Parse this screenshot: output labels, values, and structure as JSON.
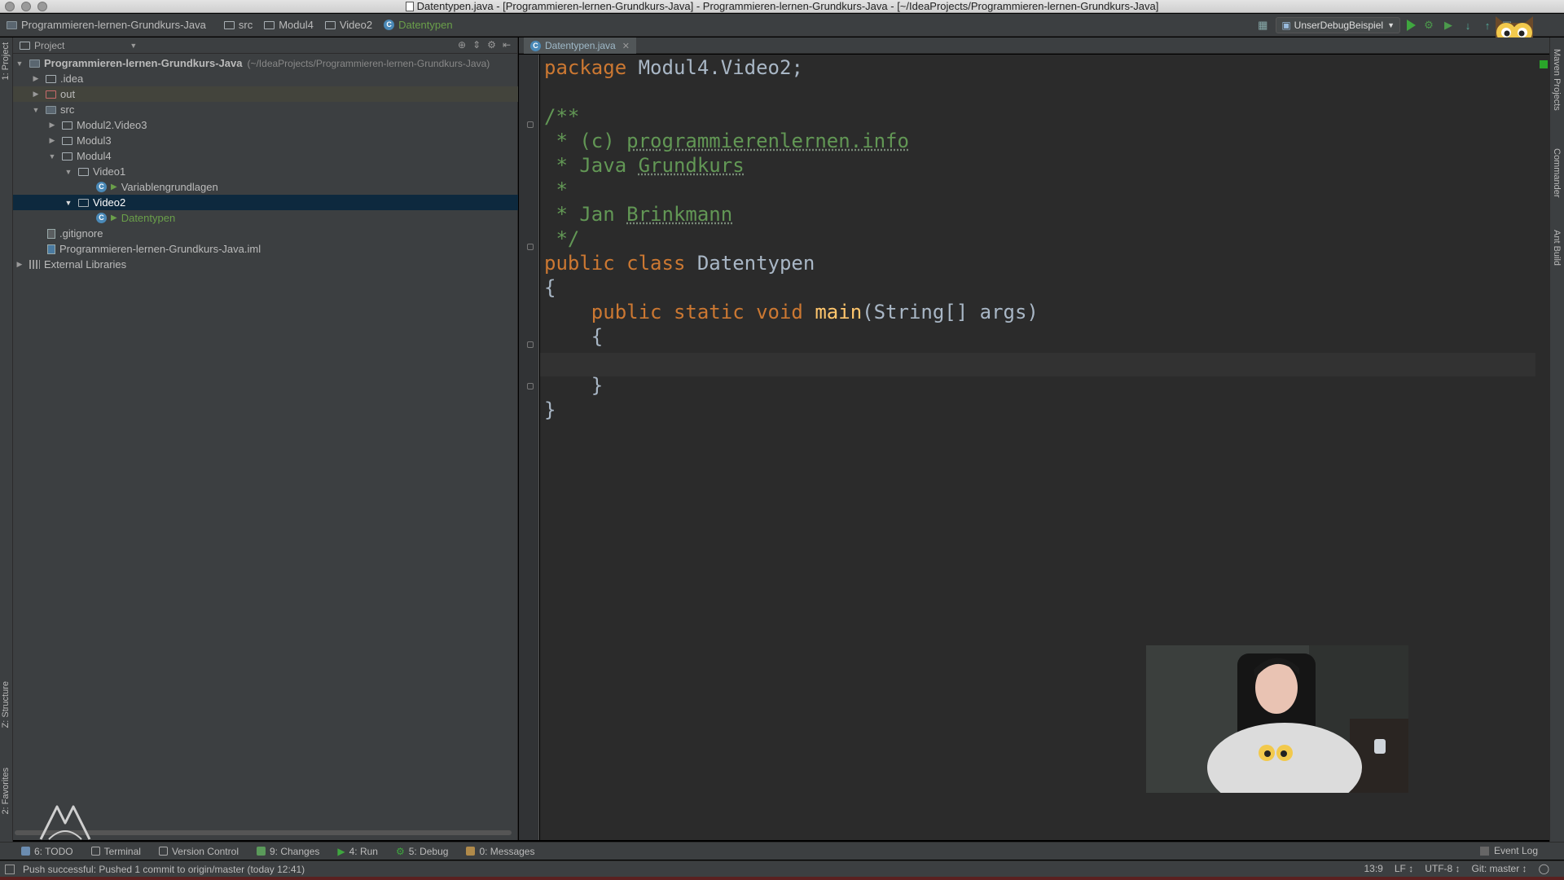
{
  "window": {
    "title": "Datentypen.java - [Programmieren-lernen-Grundkurs-Java] - Programmieren-lernen-Grundkurs-Java - [~/IdeaProjects/Programmieren-lernen-Grundkurs-Java]"
  },
  "navbar": {
    "breadcrumbs": [
      "Programmieren-lernen-Grundkurs-Java",
      "src",
      "Modul4",
      "Video2",
      "Datentypen"
    ],
    "run_config": "UnserDebugBeispiel",
    "icons": [
      "structure-icon",
      "run-icon",
      "debug-icon",
      "coverage-icon",
      "vcs-update-icon",
      "vcs-commit-icon",
      "settings-icon",
      "search-everywhere-icon"
    ]
  },
  "project_panel": {
    "header": "Project",
    "tree": [
      {
        "label": "Programmieren-lernen-Grundkurs-Java",
        "path": "(~/IdeaProjects/Programmieren-lernen-Grundkurs-Java)"
      },
      {
        "label": ".idea"
      },
      {
        "label": "out"
      },
      {
        "label": "src"
      },
      {
        "label": "Modul2.Video3"
      },
      {
        "label": "Modul3"
      },
      {
        "label": "Modul4"
      },
      {
        "label": "Video1"
      },
      {
        "label": "Variablengrundlagen"
      },
      {
        "label": "Video2"
      },
      {
        "label": "Datentypen"
      },
      {
        "label": ".gitignore"
      },
      {
        "label": "Programmieren-lernen-Grundkurs-Java.iml"
      },
      {
        "label": "External Libraries"
      }
    ]
  },
  "editor": {
    "tab": "Datentypen.java",
    "code": {
      "l1_kw": "package",
      "l1_rest": " Modul4.Video2;",
      "l3": "/**",
      "l4_a": " * (c) ",
      "l4_b": "programmierenlernen.info",
      "l5_a": " * Java ",
      "l5_b": "Grundkurs",
      "l6": " *",
      "l7_a": " * Jan ",
      "l7_b": "Brinkmann",
      "l8": " */",
      "l9_kw": "public class",
      "l9_rest": " Datentypen",
      "l10": "{",
      "l11_kw": "    public static void",
      "l11_fn": " main",
      "l11_rest": "(String[] args)",
      "l12": "    {",
      "l14": "    }",
      "l15": "}"
    }
  },
  "left_strip": {
    "project_tab": "1: Project",
    "structure_tab": "Z: Structure",
    "favorites_tab": "2: Favorites"
  },
  "right_strip": {
    "maven_tab": "Maven Projects",
    "commander_tab": "Commander",
    "ant_tab": "Ant Build"
  },
  "bottom_tools": [
    {
      "label": "6: TODO"
    },
    {
      "label": "Terminal"
    },
    {
      "label": "Version Control"
    },
    {
      "label": "9: Changes"
    },
    {
      "label": "4: Run"
    },
    {
      "label": "5: Debug"
    },
    {
      "label": "0: Messages"
    }
  ],
  "event_log": "Event Log",
  "status": {
    "message": "Push successful: Pushed 1 commit to origin/master (today 12:41)",
    "position": "13:9",
    "line_sep": "LF ↕",
    "encoding": "UTF-8 ↕",
    "vcs": "Git: master ↕"
  },
  "colors": {
    "keyword": "#cc7832",
    "comment": "#629755",
    "function": "#ffc66d",
    "text": "#a9b7c6",
    "editor_bg": "#2b2b2b",
    "panel_bg": "#3c3f41",
    "selection": "#0d293e"
  }
}
